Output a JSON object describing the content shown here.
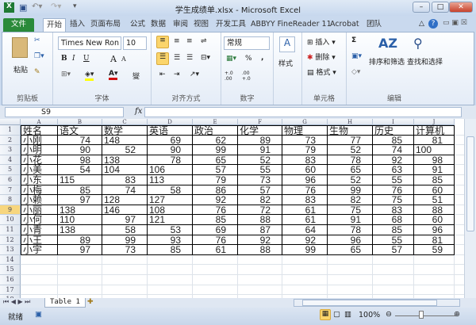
{
  "window": {
    "title": "学生成绩单.xlsx - Microsoft Excel"
  },
  "ribbon_tabs": [
    "文件",
    "开始",
    "插入",
    "页面布局",
    "公式",
    "数据",
    "审阅",
    "视图",
    "开发工具",
    "ABBYY FineReader 11",
    "Acrobat",
    "团队"
  ],
  "active_tab": "开始",
  "ribbon": {
    "clipboard": {
      "label": "剪贴板",
      "paste": "粘贴"
    },
    "font": {
      "label": "字体",
      "font_name": "Times New Ron",
      "font_size": "10",
      "bold": "B",
      "italic": "I",
      "underline": "U",
      "grow": "A",
      "shrink": "A",
      "phonetic": "燮"
    },
    "alignment": {
      "label": "对齐方式"
    },
    "number": {
      "label": "数字",
      "format": "常规",
      "percent": "%",
      "comma": ",",
      "inc_decimal": "+.0 .00",
      "dec_decimal": ".00 +.0"
    },
    "styles": {
      "label": "",
      "button": "样式"
    },
    "cells": {
      "label": "单元格",
      "insert": "插入",
      "delete": "删除",
      "format": "格式"
    },
    "editing": {
      "label": "编辑",
      "sum": "Σ",
      "sort": "排序和筛选",
      "find": "查找和选择"
    }
  },
  "formula_bar": {
    "name_box": "S9",
    "fx": "fx",
    "formula": ""
  },
  "columns": [
    "A",
    "B",
    "C",
    "D",
    "E",
    "F",
    "G",
    "H",
    "I",
    "J"
  ],
  "selected_row": 9,
  "row_count_visible": 18,
  "table": {
    "header": [
      "姓名",
      "语文",
      "数学",
      "英语",
      "政治",
      "化学",
      "物理",
      "生物",
      "历史",
      "计算机"
    ],
    "rows": [
      [
        "小刚",
        74,
        "148",
        69,
        62,
        89,
        73,
        77,
        85,
        81
      ],
      [
        "小明",
        90,
        52,
        90,
        99,
        91,
        79,
        52,
        74,
        "100"
      ],
      [
        "小花",
        98,
        "138",
        78,
        65,
        52,
        83,
        78,
        92,
        98
      ],
      [
        "小美",
        54,
        "104",
        "106",
        57,
        55,
        60,
        65,
        63,
        91
      ],
      [
        "小东",
        "115",
        83,
        "113",
        79,
        73,
        96,
        52,
        55,
        85
      ],
      [
        "小梅",
        85,
        74,
        58,
        86,
        57,
        76,
        99,
        76,
        60
      ],
      [
        "小赖",
        97,
        "128",
        "127",
        92,
        82,
        83,
        82,
        75,
        51
      ],
      [
        "小丽",
        "138",
        "146",
        "108",
        76,
        72,
        61,
        75,
        83,
        88
      ],
      [
        "小何",
        "110",
        97,
        "121",
        85,
        88,
        61,
        91,
        68,
        60
      ],
      [
        "小青",
        "138",
        58,
        53,
        69,
        87,
        64,
        78,
        85,
        96
      ],
      [
        "小王",
        89,
        99,
        93,
        76,
        92,
        92,
        96,
        55,
        81
      ],
      [
        "小宇",
        97,
        73,
        85,
        61,
        88,
        99,
        65,
        57,
        59
      ]
    ]
  },
  "sheet_tabs": [
    "Table 1"
  ],
  "status": {
    "ready": "就绪",
    "zoom": "100%"
  }
}
